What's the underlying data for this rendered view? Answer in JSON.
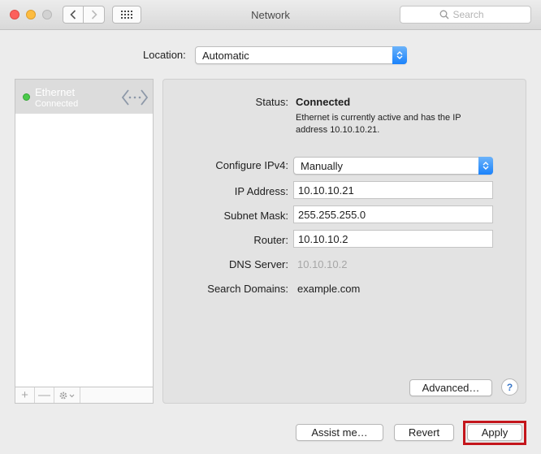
{
  "window": {
    "title": "Network"
  },
  "toolbar": {
    "back_icon": "chevron-left",
    "forward_icon": "chevron-right",
    "grid_icon": "show-all-grid",
    "search_placeholder": "Search"
  },
  "location": {
    "label": "Location:",
    "value": "Automatic"
  },
  "sidebar": {
    "services": [
      {
        "name": "Ethernet",
        "status": "Connected",
        "status_color": "#4ac94a",
        "icon": "ethernet-arrows"
      }
    ],
    "add_label": "+",
    "remove_label": "—",
    "gear_icon": "gear"
  },
  "detail": {
    "status_label": "Status:",
    "status_value": "Connected",
    "status_desc": "Ethernet is currently active and has the IP address 10.10.10.21.",
    "configure_label": "Configure IPv4:",
    "configure_value": "Manually",
    "ip_label": "IP Address:",
    "ip_value": "10.10.10.21",
    "mask_label": "Subnet Mask:",
    "mask_value": "255.255.255.0",
    "router_label": "Router:",
    "router_value": "10.10.10.2",
    "dns_label": "DNS Server:",
    "dns_value": "10.10.10.2",
    "domains_label": "Search Domains:",
    "domains_value": "example.com",
    "advanced_label": "Advanced…",
    "help_label": "?"
  },
  "footer": {
    "assist_label": "Assist me…",
    "revert_label": "Revert",
    "apply_label": "Apply",
    "highlight_color": "#c4161c"
  }
}
